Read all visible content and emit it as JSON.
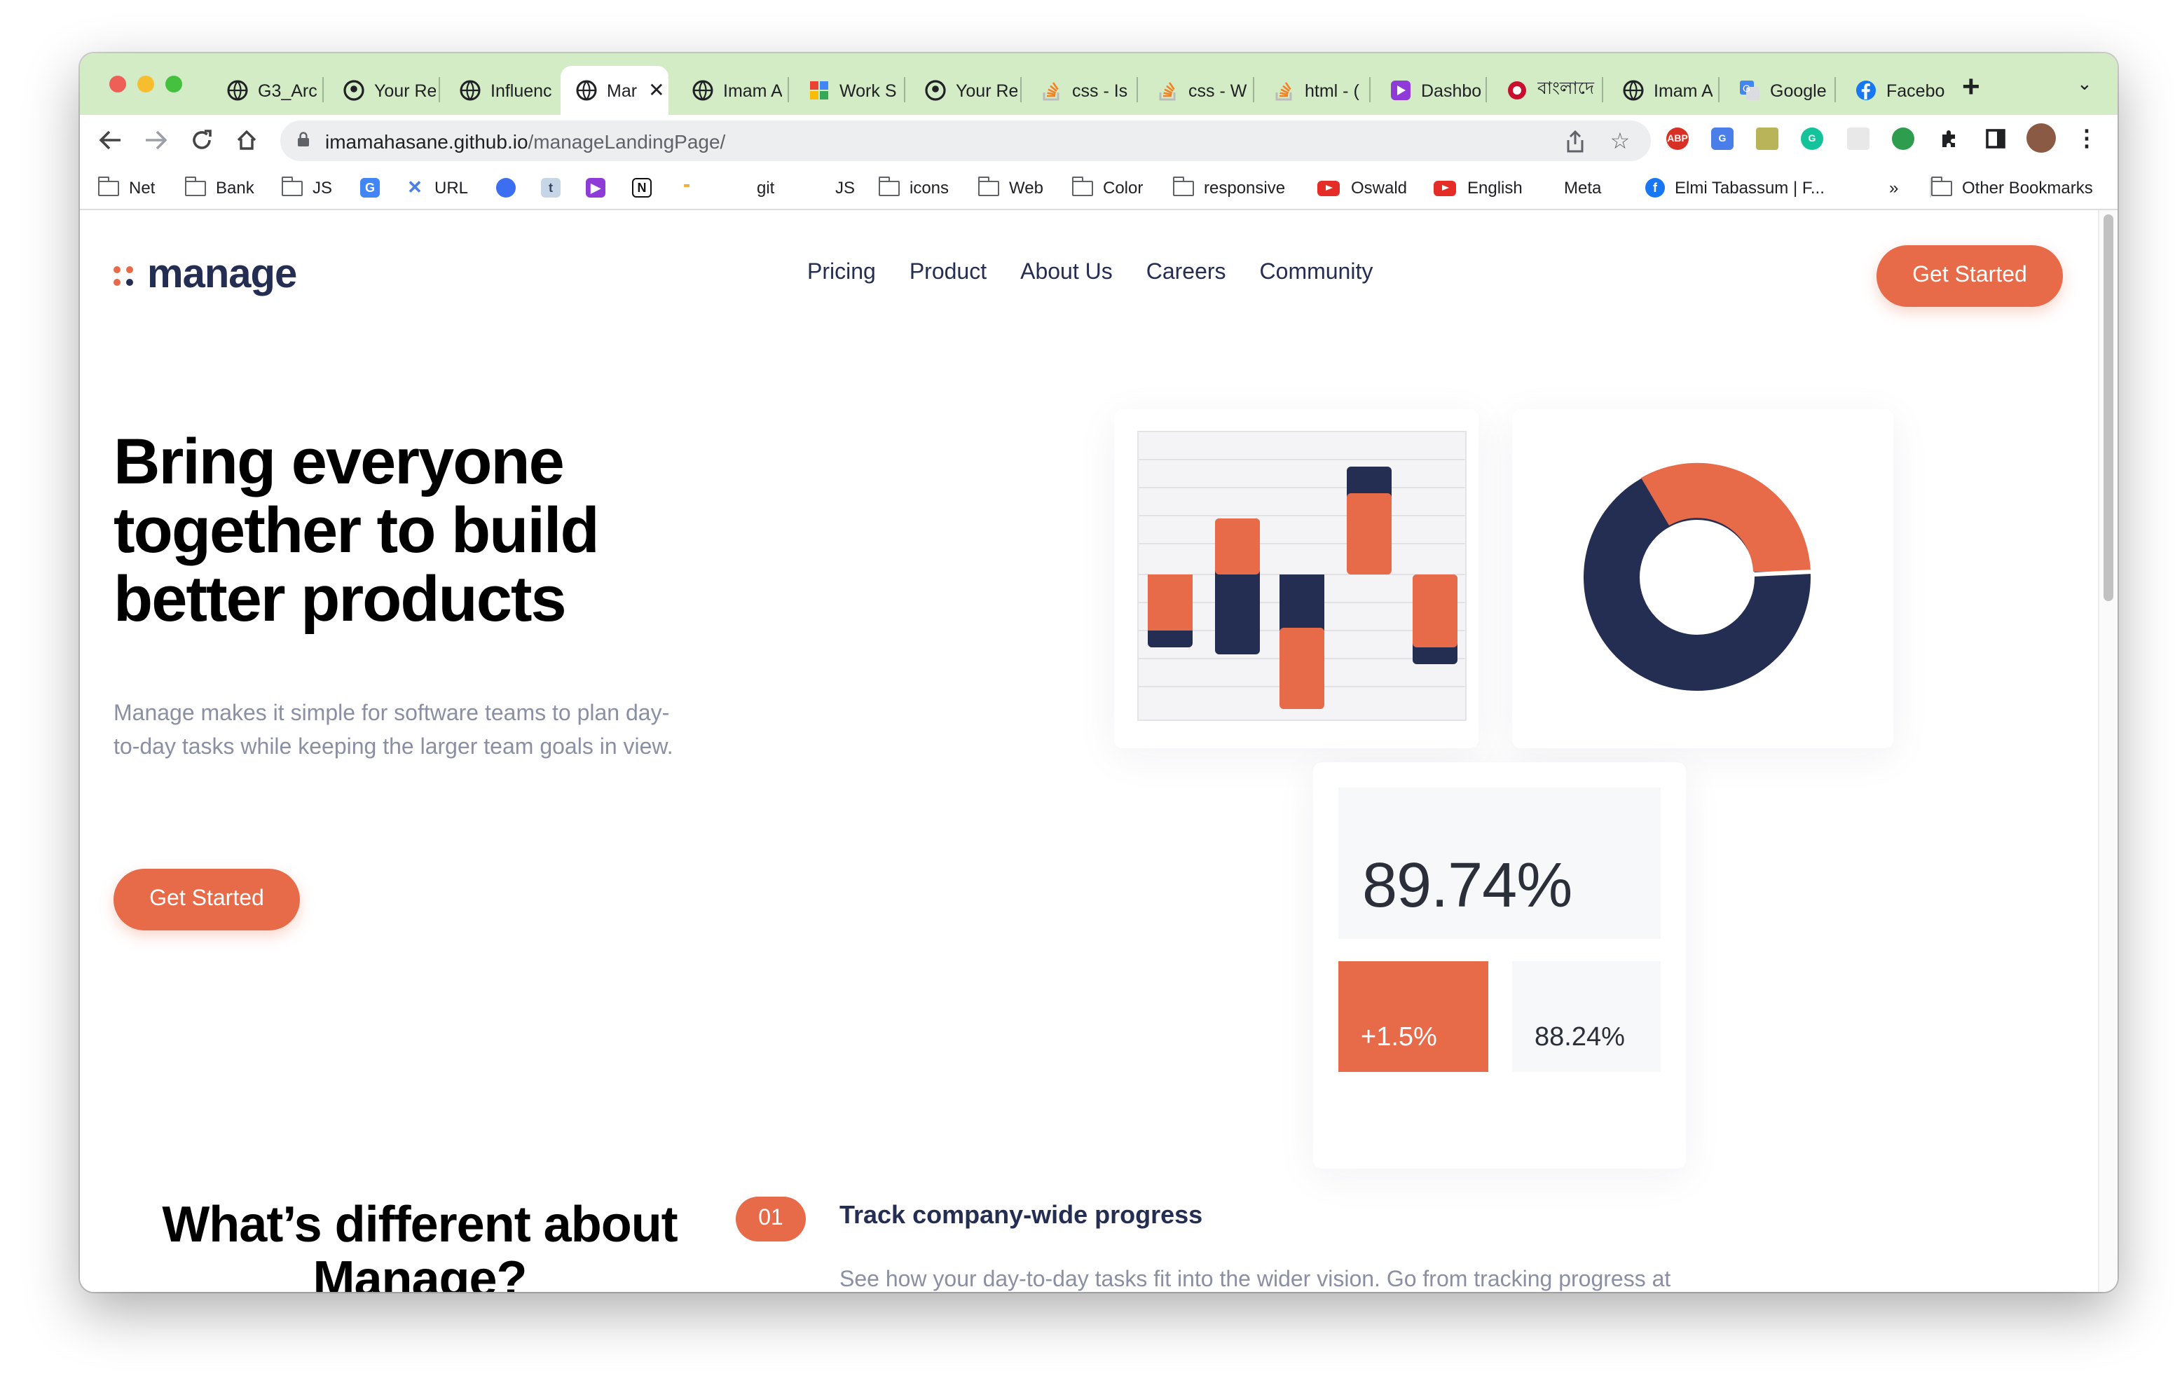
{
  "browser": {
    "tabs": [
      {
        "label": "G3_Arc",
        "icon": "globe-icon"
      },
      {
        "label": "Your Re",
        "icon": "github-icon"
      },
      {
        "label": "Influenc",
        "icon": "globe-icon"
      },
      {
        "label": "Mar",
        "icon": "globe-icon",
        "active": true
      },
      {
        "label": "Imam A",
        "icon": "globe-icon"
      },
      {
        "label": "Work S",
        "icon": "grid-app-icon"
      },
      {
        "label": "Your Re",
        "icon": "github-icon"
      },
      {
        "label": "css - Is",
        "icon": "stackoverflow-icon"
      },
      {
        "label": "css - W",
        "icon": "stackoverflow-icon"
      },
      {
        "label": "html - (",
        "icon": "stackoverflow-icon"
      },
      {
        "label": "Dashbo",
        "icon": "dashboard-app-icon"
      },
      {
        "label": "বাংলাদে",
        "icon": "news-icon"
      },
      {
        "label": "Imam A",
        "icon": "globe-icon"
      },
      {
        "label": "Google",
        "icon": "translate-icon"
      },
      {
        "label": "Facebo",
        "icon": "facebook-icon"
      }
    ],
    "close_tab_glyph": "✕",
    "new_tab_glyph": "+",
    "tab_menu_glyph": "⌄",
    "url_host": "imamahasane.github.io",
    "url_path": "/manageLandingPage/",
    "bookmarks": [
      {
        "label": "Net",
        "type": "folder"
      },
      {
        "label": "Bank",
        "type": "folder"
      },
      {
        "label": "JS",
        "type": "folder"
      },
      {
        "label": "",
        "type": "translate"
      },
      {
        "label": "URL",
        "type": "url-tool"
      },
      {
        "label": "",
        "type": "app-blue"
      },
      {
        "label": "",
        "type": "app-tumblr"
      },
      {
        "label": "",
        "type": "app-purple"
      },
      {
        "label": "",
        "type": "notion"
      },
      {
        "label": "",
        "type": "app-dash"
      },
      {
        "label": "git",
        "type": "none"
      },
      {
        "label": "JS",
        "type": "none"
      },
      {
        "label": "icons",
        "type": "folder"
      },
      {
        "label": "Web",
        "type": "folder"
      },
      {
        "label": "Color",
        "type": "folder"
      },
      {
        "label": "responsive",
        "type": "folder"
      },
      {
        "label": "Oswald",
        "type": "youtube"
      },
      {
        "label": "English",
        "type": "youtube"
      },
      {
        "label": "Meta",
        "type": "none"
      },
      {
        "label": "Elmi Tabassum | F...",
        "type": "facebook"
      }
    ],
    "bookmarks_overflow": "»",
    "other_bookmarks": "Other Bookmarks"
  },
  "page": {
    "logo": "manage",
    "nav": [
      "Pricing",
      "Product",
      "About Us",
      "Careers",
      "Community"
    ],
    "nav_cta": "Get Started",
    "hero_title": "Bring everyone together to build better products",
    "hero_sub": "Manage makes it simple for software teams to plan day-to-day tasks while keeping the larger team goals in view.",
    "hero_cta": "Get Started",
    "stats": {
      "main": "89.74%",
      "change": "+1.5%",
      "secondary": "88.24%"
    },
    "section_title": "What’s different about Manage?",
    "feature": {
      "number": "01",
      "title": "Track company-wide progress",
      "text": "See how your day-to-day tasks fit into the wider vision. Go from tracking progress at"
    }
  },
  "colors": {
    "accent": "#e76a49",
    "navy": "#242d52",
    "muted": "#8b8fa3",
    "tab_strip": "#d3ecc6"
  }
}
